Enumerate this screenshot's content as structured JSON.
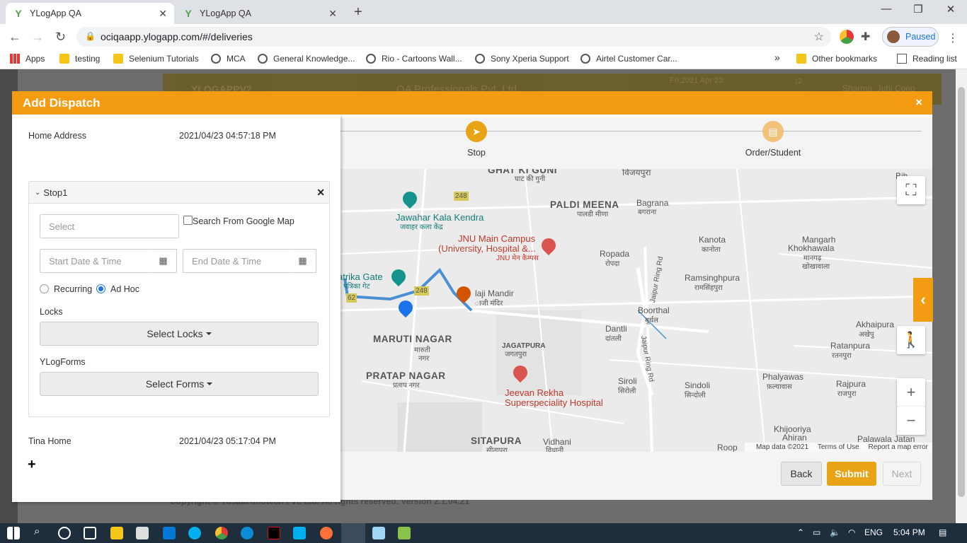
{
  "browser": {
    "tabs": [
      {
        "title": "YLogApp QA",
        "active": true
      },
      {
        "title": "YLogApp QA",
        "active": false
      }
    ],
    "url": "ociqaapp.ylogapp.com/#/deliveries",
    "profile_status": "Paused",
    "bookmarks": [
      "Apps",
      "testing",
      "Selenium Tutorials",
      "MCA",
      "General Knowledge...",
      "Rio - Cartoons Wall...",
      "Sony Xperia Support",
      "Airtel Customer Car..."
    ],
    "bookmarks_overflow": "»",
    "other_bookmarks": "Other bookmarks",
    "reading_list": "Reading list"
  },
  "background": {
    "brand": "YLOGAPPV2",
    "company": "QA Professionals Pvt. Ltd.",
    "date": "Fri,2021 Apr 23",
    "notif_count": "12",
    "user": "Sharma, Juhi Conp",
    "footer": "Copyright © Yusata Infotech Pvt. Ltd. All rights reserved. Version 2.1.04.21"
  },
  "modal": {
    "title": "Add Dispatch",
    "close": "×",
    "home_address_label": "Home Address",
    "home_address_time": "2021/04/23 04:57:18 PM",
    "stop": {
      "title": "Stop1",
      "location_placeholder": "Select",
      "google_map_label": "Search From Google Map",
      "start_placeholder": "Start Date & Time",
      "end_placeholder": "End Date & Time",
      "recurring_label": "Recurring",
      "adhoc_label": "Ad Hoc",
      "selected_type": "Ad Hoc",
      "locks_label": "Locks",
      "locks_button": "Select Locks",
      "forms_label": "YLogForms",
      "forms_button": "Select Forms"
    },
    "destination_label": "Tina Home",
    "destination_time": "2021/04/23 05:17:04 PM",
    "add_stop": "+",
    "steps": [
      {
        "label": "Stop",
        "icon": "navigation-arrow-icon"
      },
      {
        "label": "Order/Student",
        "icon": "id-card-icon"
      }
    ],
    "buttons": {
      "back": "Back",
      "submit": "Submit",
      "next": "Next"
    }
  },
  "map": {
    "labels": {
      "ghat_ki_guni": "GHAT KI GUNI",
      "ghat_ki_guni_hi": "घाट की गुनी",
      "vijaypura": "विजयपुरा",
      "paldi_meena": "PALDI MEENA",
      "paldi_meena_hi": "पालडी मीणा",
      "bagrana": "Bagrana",
      "bagrana_hi": "बगराना",
      "bih": "Bih",
      "jawahar": "Jawahar Kala Kendra",
      "jawahar_hi": "जवाहर कला केंद्र",
      "jnu": "JNU Main Campus",
      "jnu2": "(University, Hospital &...",
      "jnu_hi": "JNU मेन कैम्पस",
      "ropada": "Ropada",
      "ropada_hi": "रोपदा",
      "kanota": "Kanota",
      "kanota_hi": "कानोता",
      "mangarh": "Mangarh",
      "mangarh2": "Khokhawala",
      "mangarh_hi": "मानगढ़",
      "mangarh_hi2": "खोखावाला",
      "ramsinghpura": "Ramsinghpura",
      "ramsinghpura_hi": "रामसिंहपुरा",
      "patrika": "atrika Gate",
      "patrika_hi": "पत्रिका गेट",
      "mandir": "laji Mandir",
      "mandir_hi": "ाजी मंदिर",
      "boorthal": "Boorthal",
      "boorthal_hi": "बूर्थल",
      "akhaipura": "Akhaipura",
      "akhaipura_hi": "अखेपु",
      "maruti": "MARUTI NAGAR",
      "maruti_hi": "मारुती",
      "maruti_hi2": "नगर",
      "jagatpura": "JAGATPURA",
      "jagatpura_hi": "जगतपुरा",
      "dantli": "Dantli",
      "dantli_hi": "दांतली",
      "ratanpura": "Ratanpura",
      "ratanpura_hi": "रतनपुरा",
      "pratap": "PRATAP NAGAR",
      "pratap_hi": "प्रताप नगर",
      "jeevan": "Jeevan Rekha",
      "jeevan2": "Superspeciality Hospital",
      "siroli": "Siroli",
      "siroli_hi": "सिरोली",
      "sindoli": "Sindoli",
      "sindoli_hi": "सिन्दोली",
      "phalyawas": "Phalyawas",
      "phalyawas_hi": "फ़ल्यावास",
      "rajpura": "Rajpura",
      "rajpura_hi": "राजपुरा",
      "sitapura": "SITAPURA",
      "sitapura_hi": "सीतापुरा",
      "vidhani": "Vidhani",
      "vidhani_hi": "विधानी",
      "khijooriya": "Khijooriya",
      "khijooriya2": "Ahiran",
      "palawala": "Palawala Jatan",
      "roop": "Roop",
      "jaipur_ring_rd": "Jaipur Ring Rd",
      "shield_248": "248",
      "shield_62": "62"
    },
    "attribution": [
      "Map data ©2021",
      "Terms of Use",
      "Report a map error"
    ],
    "fullscreen_label": "⛶",
    "zoom_in": "+",
    "zoom_out": "−",
    "pegman_label": "🚶",
    "side_toggle": "‹"
  },
  "taskbar": {
    "lang": "ENG",
    "time": "5:04 PM"
  },
  "colors": {
    "accent": "#f39c12",
    "submit": "#e8a317",
    "route": "#4a8fd6"
  }
}
